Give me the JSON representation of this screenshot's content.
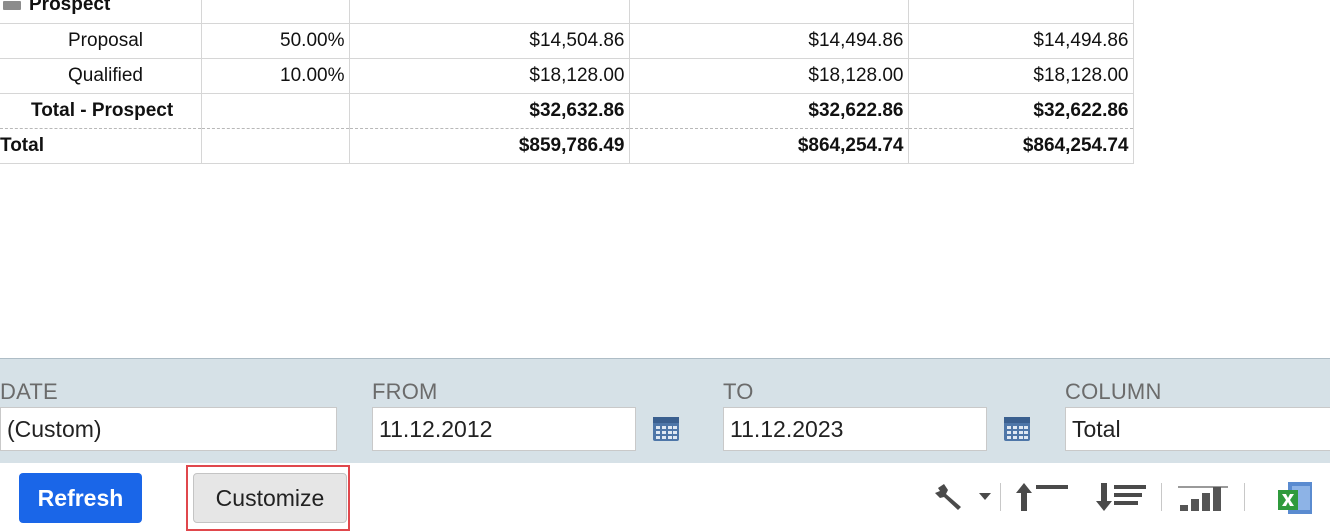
{
  "report": {
    "group_label": "Prospect",
    "rows": [
      {
        "label": "Proposal",
        "probability": "50.00%",
        "col1": "$14,504.86",
        "col2": "$14,494.86",
        "col3": "$14,494.86"
      },
      {
        "label": "Qualified",
        "probability": "10.00%",
        "col1": "$18,128.00",
        "col2": "$18,128.00",
        "col3": "$18,128.00"
      }
    ],
    "subtotal": {
      "label": "Total - Prospect",
      "col1": "$32,632.86",
      "col2": "$32,622.86",
      "col3": "$32,622.86"
    },
    "total": {
      "label": "Total",
      "col1": "$859,786.49",
      "col2": "$864,254.74",
      "col3": "$864,254.74"
    }
  },
  "filters": {
    "date": {
      "label": "DATE",
      "value": "(Custom)"
    },
    "from": {
      "label": "FROM",
      "value": "11.12.2012"
    },
    "to": {
      "label": "TO",
      "value": "11.12.2023"
    },
    "column": {
      "label": "COLUMN",
      "value": "Total"
    }
  },
  "buttons": {
    "refresh_label": "Refresh",
    "customize_label": "Customize"
  },
  "toolbar_icons": [
    "wrench-icon",
    "dropdown-arrow-icon",
    "collapse-all-icon",
    "expand-all-icon",
    "chart-icon",
    "excel-export-icon"
  ],
  "colors": {
    "refresh_bg": "#1a66e8",
    "filter_bar_bg": "#d6e1e7",
    "highlight_border": "#e0474c",
    "excel_green": "#2f9a3c"
  }
}
